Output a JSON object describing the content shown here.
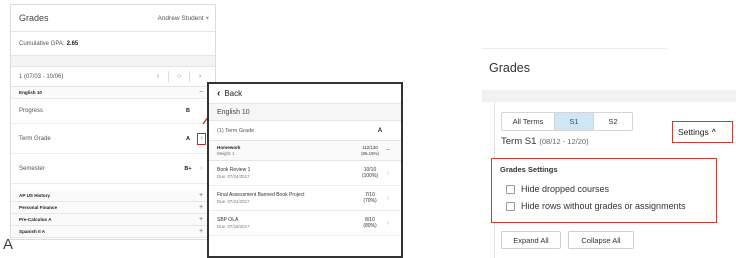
{
  "panel_a": {
    "title": "Grades",
    "user": "Andrew Student",
    "gpa_label": "Cumulative GPA:",
    "gpa_value": "2.65",
    "term_label": "1 (07/03 - 10/06)",
    "course_main": "English 10",
    "rows": [
      {
        "label": "Progress",
        "grade": "B"
      },
      {
        "label": "Term Grade",
        "grade": "A"
      },
      {
        "label": "Semester",
        "grade": "B+"
      }
    ],
    "other_courses": [
      "AP US History",
      "Personal Finance",
      "Pre-Calculus A",
      "Spanish II A"
    ],
    "corner_letter": "A",
    "expand_glyph": "+",
    "collapse_glyph": "−"
  },
  "panel_b": {
    "back_label": "Back",
    "course": "English 10",
    "term_row": {
      "label": "(1) Term Grade",
      "grade": "A"
    },
    "category": {
      "name": "Homework",
      "weight": "Weight: 1",
      "score": "112/130",
      "percent": "(86.15%)"
    },
    "assignments": [
      {
        "name": "Book Review 1",
        "due": "Due: 07/24/2017",
        "score": "10/10",
        "percent": "(100%)"
      },
      {
        "name": "Final Assessment Banned Book Project",
        "due": "Due: 07/21/2017",
        "score": "7/10",
        "percent": "(70%)"
      },
      {
        "name": "SBP OLA",
        "due": "Due: 07/19/2017",
        "score": "8/10",
        "percent": "(80%)"
      }
    ]
  },
  "panel_c": {
    "title": "Grades",
    "tabs": [
      "All Terms",
      "S1",
      "S2"
    ],
    "term_name": "Term S1",
    "term_dates": "(08/12 - 12/20)",
    "settings_label": "Settings",
    "settings_header": "Grades Settings",
    "options": [
      "Hide dropped courses",
      "Hide rows without grades or assignments"
    ],
    "expand_all": "Expand All",
    "collapse_all": "Collapse All"
  },
  "colors": {
    "highlight_red": "#d23a35",
    "tab_selected_bg": "#cfe6f4",
    "tab_selected_text": "#1a5a86"
  }
}
